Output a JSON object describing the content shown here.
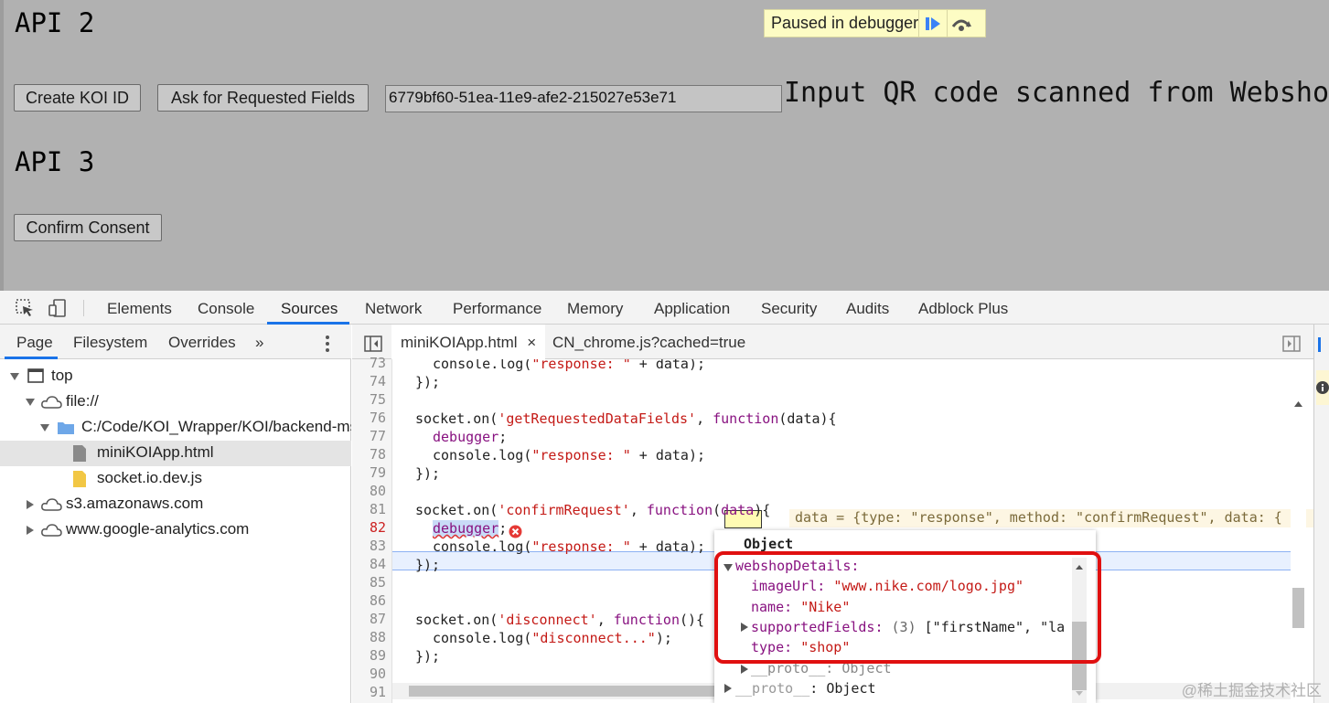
{
  "page": {
    "api2_heading": "API 2",
    "api3_heading": "API 3",
    "create_koi_label": "Create KOI ID",
    "ask_fields_label": "Ask for Requested Fields",
    "koi_id_value": "6779bf60-51ea-11e9-afe2-215027e53e71",
    "qr_label": "Input QR code scanned from Websho",
    "confirm_consent_label": "Confirm Consent",
    "paused_text": "Paused in debugger"
  },
  "devtools": {
    "main_tabs": [
      "Elements",
      "Console",
      "Sources",
      "Network",
      "Performance",
      "Memory",
      "Application",
      "Security",
      "Audits",
      "Adblock Plus"
    ],
    "active_tab": "Sources",
    "nav_tabs": [
      "Page",
      "Filesystem",
      "Overrides",
      "»"
    ],
    "tree": [
      {
        "label": "top"
      },
      {
        "label": "file://"
      },
      {
        "label": "C:/Code/KOI_Wrapper/KOI/backend-ms/"
      },
      {
        "label": "miniKOIApp.html"
      },
      {
        "label": "socket.io.dev.js"
      },
      {
        "label": "s3.amazonaws.com"
      },
      {
        "label": "www.google-analytics.com"
      }
    ],
    "editor_tabs": [
      "miniKOIApp.html",
      "CN_chrome.js?cached=true"
    ],
    "editor_tab_close": "×",
    "line_numbers": [
      "73",
      "74",
      "75",
      "76",
      "77",
      "78",
      "79",
      "80",
      "81",
      "82",
      "83",
      "84",
      "85",
      "86",
      "87",
      "88",
      "89",
      "90",
      "91"
    ],
    "inline_value": "data = {type: \"response\", method: \"confirmRequest\", data: {",
    "code": {
      "l73_a": "console.log(",
      "l73_s": "\"response: \"",
      "l73_b": " + data);",
      "l74": "});",
      "l76_a": "socket.on(",
      "l76_s": "'getRequestedDataFields'",
      "l76_b": ", ",
      "l76_k": "function",
      "l76_c": "(data){",
      "l77": "debugger",
      "l77_b": ";",
      "l78_a": "console.log(",
      "l78_s": "\"response: \"",
      "l78_b": " + data);",
      "l79": "});",
      "l81_a": "socket.on(",
      "l81_s": "'confirmRequest'",
      "l81_b": ", ",
      "l81_k": "function",
      "l81_c": "(",
      "l81_d": "data",
      "l81_e": "){",
      "l82": "debugger",
      "l82_b": ";",
      "l83_a": "console.log(",
      "l83_s": "\"response: \"",
      "l83_b": " + data);",
      "l84": "});",
      "l87_a": "socket.on(",
      "l87_s": "'disconnect'",
      "l87_b": ", ",
      "l87_k": "function",
      "l87_c": "(){",
      "l88_a": "console.log(",
      "l88_s": "\"disconnect...\"",
      "l88_b": ");",
      "l89": "});"
    },
    "popover": {
      "title": "Object",
      "webshop_key": "webshopDetails:",
      "image_key": "imageUrl:",
      "image_val": "\"www.nike.com/logo.jpg\"",
      "name_key": "name:",
      "name_val": "\"Nike\"",
      "fields_key": "supportedFields:",
      "fields_count": "(3)",
      "fields_val": "[\"firstName\", \"la",
      "type_key": "type:",
      "type_val": "\"shop\"",
      "proto_inner": "__proto__: Object",
      "proto_key": "__proto__",
      "proto_val": ": Object"
    }
  },
  "watermark": "@稀土掘金技术社区"
}
